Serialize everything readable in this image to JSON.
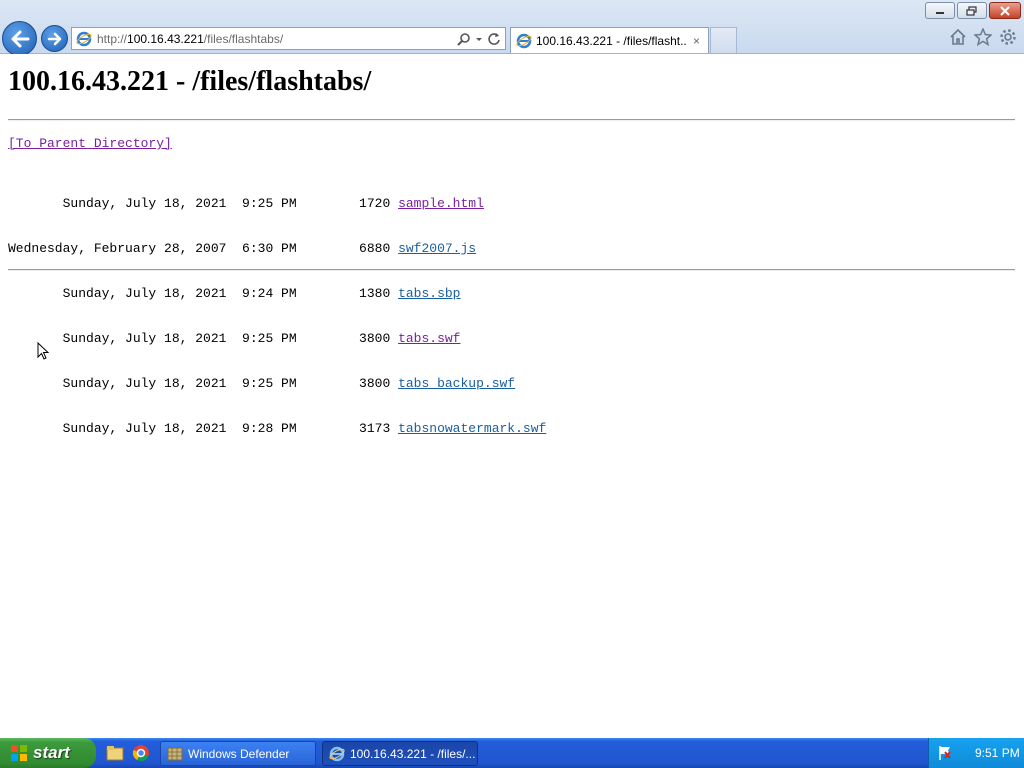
{
  "browser": {
    "url_prefix": "http://",
    "url_host": "100.16.43.221",
    "url_path": "/files/flashtabs/",
    "tab_title": "100.16.43.221 - /files/flasht...",
    "tab_close": "×"
  },
  "page": {
    "heading": "100.16.43.221 - /files/flashtabs/",
    "parent_link": "[To Parent Directory]",
    "entries": [
      {
        "date": "       Sunday, July 18, 2021  9:25 PM        1720 ",
        "name": "sample.html",
        "visited": true
      },
      {
        "date": "Wednesday, February 28, 2007  6:30 PM        6880 ",
        "name": "swf2007.js",
        "visited": false
      },
      {
        "date": "       Sunday, July 18, 2021  9:24 PM        1380 ",
        "name": "tabs.sbp",
        "visited": false
      },
      {
        "date": "       Sunday, July 18, 2021  9:25 PM        3800 ",
        "name": "tabs.swf",
        "visited": true
      },
      {
        "date": "       Sunday, July 18, 2021  9:25 PM        3800 ",
        "name": "tabs backup.swf",
        "visited": false
      },
      {
        "date": "       Sunday, July 18, 2021  9:28 PM        3173 ",
        "name": "tabsnowatermark.swf",
        "visited": false
      }
    ]
  },
  "taskbar": {
    "start_label": "start",
    "tasks": [
      {
        "label": "Windows Defender",
        "icon": "defender-icon"
      },
      {
        "label": "100.16.43.221 - /files/...",
        "icon": "ie-icon"
      }
    ],
    "clock": "9:51 PM"
  },
  "colors": {
    "visited_link": "#7b1fa2",
    "link": "#1a5fa0",
    "taskbar": "#245edb",
    "start": "#3c9a3c"
  }
}
